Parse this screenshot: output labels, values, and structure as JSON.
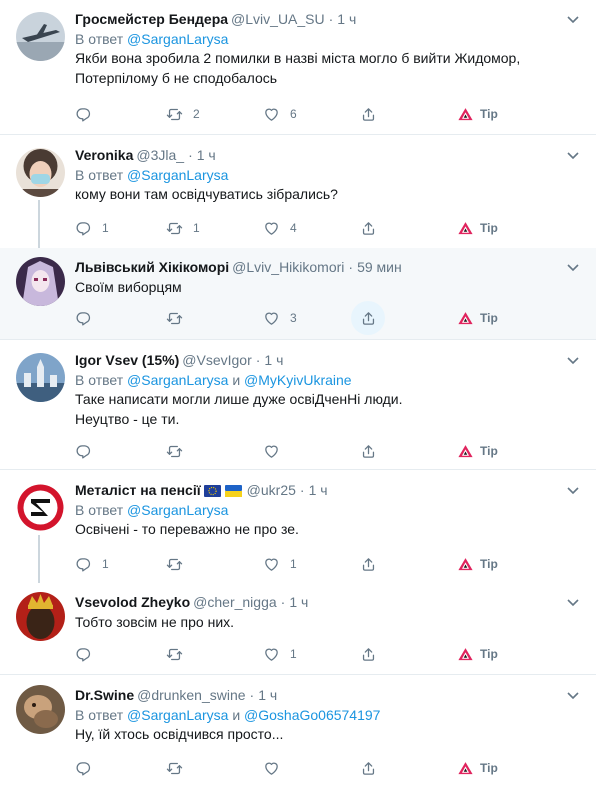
{
  "reply_prefix": "В ответ",
  "reply_join": "и",
  "tip_label": "Tip",
  "colors": {
    "text": "#14171a",
    "muted": "#657786",
    "link": "#1b95e0",
    "divider": "#e6ecf0",
    "highlight": "#f5f8fa",
    "tip_red": "#e0245e"
  },
  "tweets": [
    {
      "name": "Гросмейстер Бендера",
      "handle": "@Lviv_UA_SU",
      "time": "1 ч",
      "mentions": [
        "@SarganLarysa"
      ],
      "text": "Якби вона зробила 2 помилки в назві міста могло б вийти Жидомор,\nПотерпілому б не сподобалось",
      "replies": "",
      "retweets": "2",
      "likes": "6",
      "avatar_icon": "aircraft-avatar"
    },
    {
      "name": "Veronika",
      "handle": "@3Jla_",
      "time": "1 ч",
      "mentions": [
        "@SarganLarysa"
      ],
      "text": "кому вони там освідчуватись зібрались?",
      "replies": "1",
      "retweets": "1",
      "likes": "4",
      "avatar_icon": "masked-person-avatar"
    },
    {
      "name": "Львівський Хікікоморі",
      "handle": "@Lviv_Hikikomori",
      "time": "59 мин",
      "mentions": [],
      "text": "Своїм виборцям",
      "replies": "",
      "retweets": "",
      "likes": "3",
      "avatar_icon": "anime-character-avatar"
    },
    {
      "name": "Igor Vsev (15%)",
      "handle": "@VsevIgor",
      "time": "1 ч",
      "mentions": [
        "@SarganLarysa",
        "@MyKyivUkraine"
      ],
      "text": "Таке написати могли лише дуже освіДченНі люди.\nНеуцтво - це ти.",
      "replies": "",
      "retweets": "",
      "likes": "",
      "avatar_icon": "city-skyline-avatar"
    },
    {
      "name": "Металіст на пенсії",
      "handle": "@ukr25",
      "time": "1 ч",
      "mentions": [
        "@SarganLarysa"
      ],
      "text": "Освічені - то переважно не про зе.",
      "replies": "1",
      "retweets": "",
      "likes": "1",
      "avatar_icon": "emblem-avatar",
      "flag_icons": [
        "eu-flag-icon",
        "ukraine-flag-icon"
      ]
    },
    {
      "name": "Vsevolod Zheyko",
      "handle": "@cher_nigga",
      "time": "1 ч",
      "mentions": [],
      "text": "Тобто зовсім не про них.",
      "replies": "",
      "retweets": "",
      "likes": "1",
      "avatar_icon": "crowned-person-avatar"
    },
    {
      "name": "Dr.Swine",
      "handle": "@drunken_swine",
      "time": "1 ч",
      "mentions": [
        "@SarganLarysa",
        "@GoshaGo06574197"
      ],
      "text": "Ну, їй хтось освідчився просто...",
      "replies": "",
      "retweets": "",
      "likes": "",
      "avatar_icon": "photo-avatar"
    }
  ]
}
